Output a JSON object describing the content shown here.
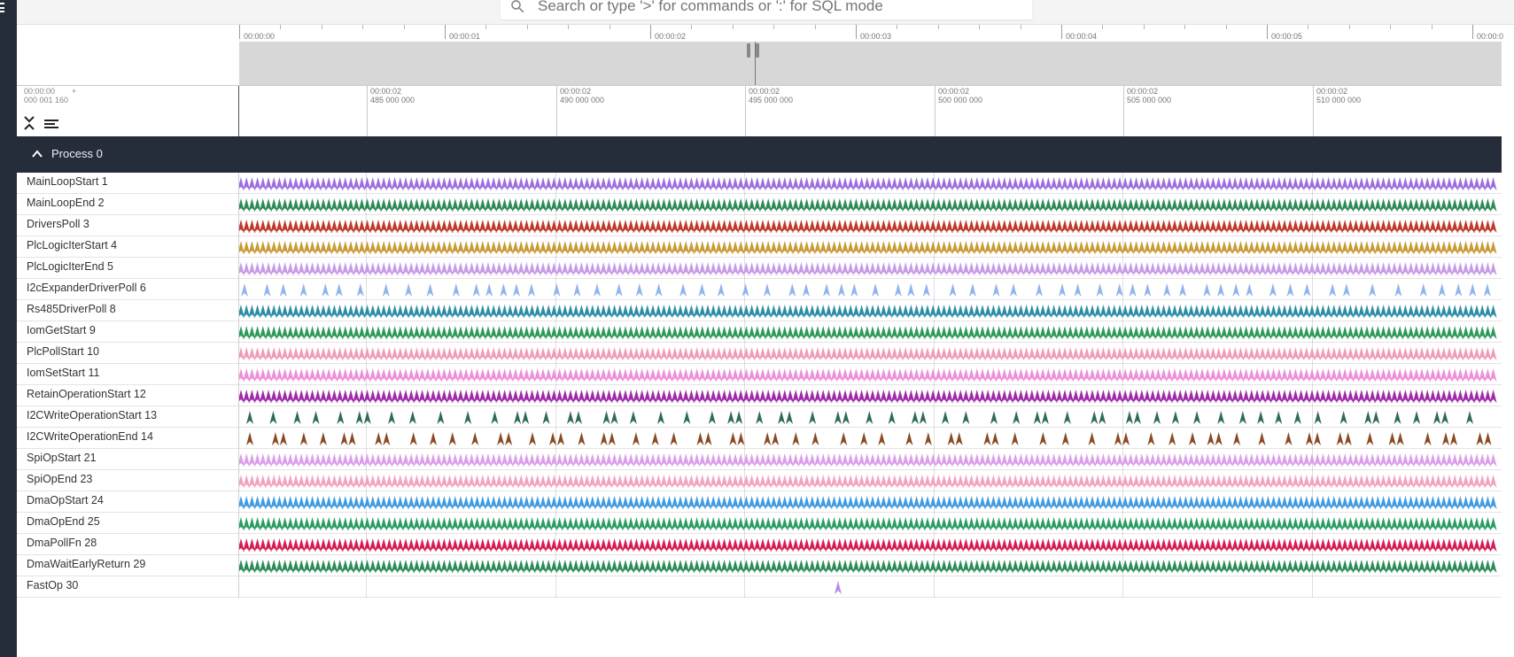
{
  "app": {
    "search_placeholder": "Search or type '>' for commands or ':' for SQL mode"
  },
  "overview": {
    "tick_labels": [
      "00:00:00",
      "00:00:01",
      "00:00:02",
      "00:00:03",
      "00:00:04",
      "00:00:05",
      "00:00:0"
    ]
  },
  "detail": {
    "offset_line1": "00:00:00",
    "offset_line2": "000 001 160",
    "plus": "+",
    "ticks": [
      {
        "line1": "00:00:02",
        "line2": "485 000 000"
      },
      {
        "line1": "00:00:02",
        "line2": "490 000 000"
      },
      {
        "line1": "00:00:02",
        "line2": "495 000 000"
      },
      {
        "line1": "00:00:02",
        "line2": "500 000 000"
      },
      {
        "line1": "00:00:02",
        "line2": "505 000 000"
      },
      {
        "line1": "00:00:02",
        "line2": "510 000 000"
      }
    ]
  },
  "process": {
    "title": "Process 0"
  },
  "tracks": [
    {
      "name": "MainLoopStart 1",
      "color": "#9b6fe0",
      "pattern": "dense"
    },
    {
      "name": "MainLoopEnd 2",
      "color": "#2e8b57",
      "pattern": "dense"
    },
    {
      "name": "DriversPoll 3",
      "color": "#c0392b",
      "pattern": "dense"
    },
    {
      "name": "PlcLogicIterStart 4",
      "color": "#c99a35",
      "pattern": "dense"
    },
    {
      "name": "PlcLogicIterEnd 5",
      "color": "#c79be8",
      "pattern": "dense"
    },
    {
      "name": "I2cExpanderDriverPoll 6",
      "color": "#8fb4ee",
      "pattern": "sparse"
    },
    {
      "name": "Rs485DriverPoll 8",
      "color": "#2e8da6",
      "pattern": "dense"
    },
    {
      "name": "IomGetStart 9",
      "color": "#2e9a5a",
      "pattern": "dense"
    },
    {
      "name": "PlcPollStart 10",
      "color": "#f29bb7",
      "pattern": "dense"
    },
    {
      "name": "IomSetStart 11",
      "color": "#ee8fd8",
      "pattern": "dense"
    },
    {
      "name": "RetainOperationStart 12",
      "color": "#a02ba8",
      "pattern": "dense"
    },
    {
      "name": "I2CWriteOperationStart 13",
      "color": "#2e6b5a",
      "pattern": "spaced"
    },
    {
      "name": "I2CWriteOperationEnd 14",
      "color": "#8a4a22",
      "pattern": "spaced"
    },
    {
      "name": "SpiOpStart 21",
      "color": "#dca0ea",
      "pattern": "dense"
    },
    {
      "name": "SpiOpEnd 23",
      "color": "#f2a3c2",
      "pattern": "dense"
    },
    {
      "name": "DmaOpStart 24",
      "color": "#3f9be3",
      "pattern": "dense"
    },
    {
      "name": "DmaOpEnd 25",
      "color": "#2a9d62",
      "pattern": "dense"
    },
    {
      "name": "DmaPollFn 28",
      "color": "#d81b55",
      "pattern": "dense"
    },
    {
      "name": "DmaWaitEarlyReturn 29",
      "color": "#2e8b57",
      "pattern": "dense"
    },
    {
      "name": "FastOp 30",
      "color": "#b88be8",
      "pattern": "single"
    }
  ]
}
